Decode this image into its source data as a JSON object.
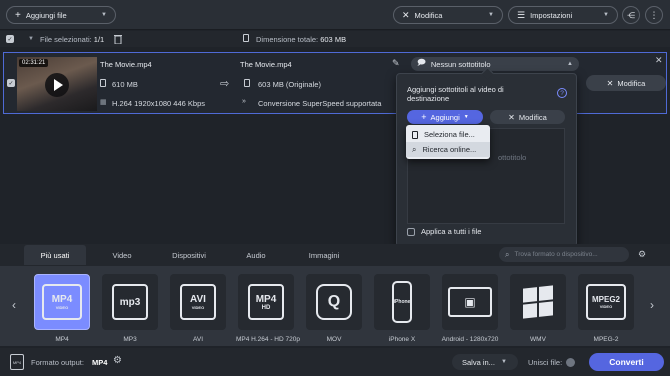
{
  "toolbar": {
    "add_files": "Aggiungi file",
    "edit": "Modifica",
    "settings": "Impostazioni"
  },
  "header": {
    "selected_label": "File selezionati:",
    "selected_count": "1/1",
    "total_size_label": "Dimensione totale:",
    "total_size": "603 MB"
  },
  "file": {
    "duration": "02:31:21",
    "source_name": "The Movie.mp4",
    "source_size": "610 MB",
    "source_info": "H.264 1920x1080 446 Kbps",
    "output_name": "The Movie.mp4",
    "output_size": "603 MB (Originale)",
    "superspeed": "Conversione SuperSpeed supportata",
    "edit_label": "Modifica"
  },
  "subtitles": {
    "selected": "Nessun sottotitolo",
    "popup_title": "Aggiungi sottotitoli al video di destinazione",
    "add_label": "Aggiungi",
    "edit_label": "Modifica",
    "placeholder_partial": "ottotitolo",
    "apply_all": "Applica a tutti i file",
    "menu": [
      "Seleziona file...",
      "Ricerca online..."
    ]
  },
  "tabs": [
    "Più usati",
    "Video",
    "Dispositivi",
    "Audio",
    "Immagini"
  ],
  "search_placeholder": "Trova formato o dispositivo...",
  "formats": [
    {
      "label": "MP4",
      "icon": "MP4"
    },
    {
      "label": "MP3",
      "icon": "mp3"
    },
    {
      "label": "AVI",
      "icon": "AVI"
    },
    {
      "label": "MP4 H.264 - HD 720p",
      "icon": "MP4"
    },
    {
      "label": "MOV",
      "icon": "quicktime"
    },
    {
      "label": "iPhone X",
      "icon": "iPhone"
    },
    {
      "label": "Android - 1280x720",
      "icon": "android"
    },
    {
      "label": "WMV",
      "icon": "windows"
    },
    {
      "label": "MPEG-2",
      "icon": "MPEG2"
    }
  ],
  "bottom": {
    "output_format_label": "Formato output:",
    "output_format": "MP4",
    "save_in": "Salva in...",
    "merge_label": "Unisci file:",
    "convert": "Converti"
  },
  "colors": {
    "accent": "#5566e0",
    "selected_format": "#7b8cff",
    "convert": "#5566e0"
  }
}
